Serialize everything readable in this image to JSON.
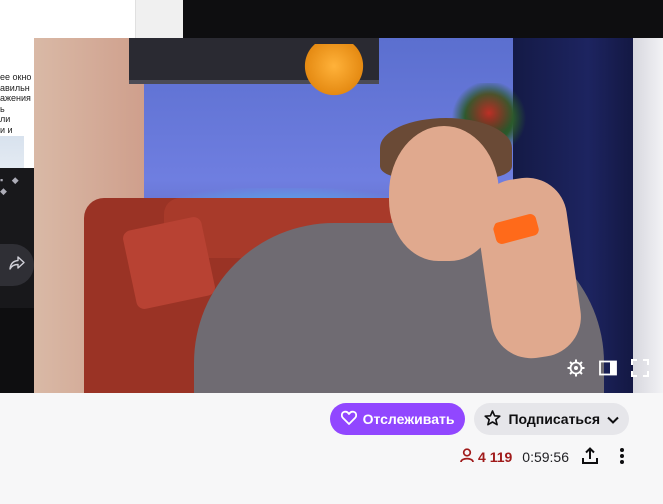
{
  "background_window": {
    "doc_lines": [
      "ее окно",
      "авильн",
      "ажения",
      "ь",
      "ли",
      "и и"
    ],
    "mini_icons": "▪ ◆ ◆"
  },
  "stream": {
    "follow_label": "Отслеживать",
    "subscribe_label": "Подписаться",
    "viewer_count": "4 119",
    "uptime": "0:59:56"
  },
  "colors": {
    "accent": "#9147ff",
    "viewer_red": "#a01a1a",
    "subscribe_bg": "#e6e6ea"
  },
  "icons": {
    "settings": "gear-icon",
    "theatre": "theatre-mode-icon",
    "fullscreen": "fullscreen-icon",
    "share": "share-icon",
    "more": "more-vertical-icon",
    "heart": "heart-icon",
    "star": "star-icon",
    "chevron": "chevron-down-icon",
    "viewer": "person-icon"
  }
}
